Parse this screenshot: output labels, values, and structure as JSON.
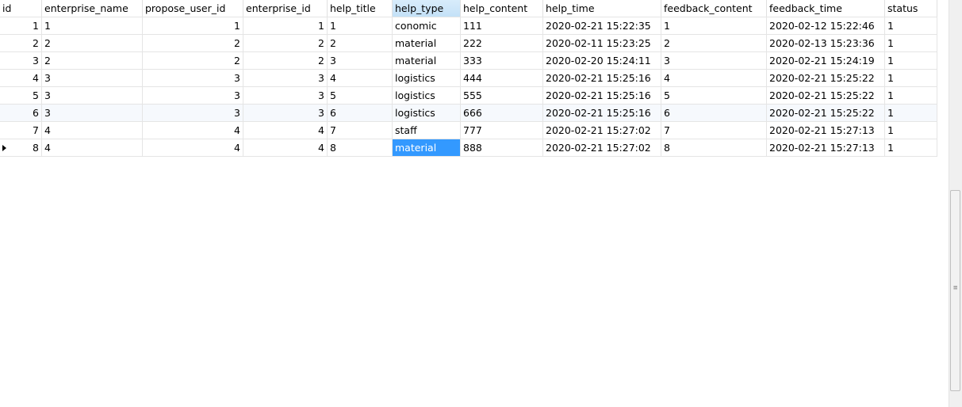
{
  "table": {
    "columns": [
      "id",
      "enterprise_name",
      "propose_user_id",
      "enterprise_id",
      "help_title",
      "help_type",
      "help_content",
      "help_time",
      "feedback_content",
      "feedback_time",
      "status"
    ],
    "sorted_column": "help_type",
    "rows": [
      [
        "1",
        "1",
        "1",
        "1",
        "1",
        "conomic",
        "111",
        "2020-02-21 15:22:35",
        "1",
        "2020-02-12 15:22:46",
        "1"
      ],
      [
        "2",
        "2",
        "2",
        "2",
        "2",
        "material",
        "222",
        "2020-02-11 15:23:25",
        "2",
        "2020-02-13 15:23:36",
        "1"
      ],
      [
        "3",
        "2",
        "2",
        "2",
        "3",
        "material",
        "333",
        "2020-02-20 15:24:11",
        "3",
        "2020-02-21 15:24:19",
        "1"
      ],
      [
        "4",
        "3",
        "3",
        "3",
        "4",
        "logistics",
        "444",
        "2020-02-21 15:25:16",
        "4",
        "2020-02-21 15:25:22",
        "1"
      ],
      [
        "5",
        "3",
        "3",
        "3",
        "5",
        "logistics",
        "555",
        "2020-02-21 15:25:16",
        "5",
        "2020-02-21 15:25:22",
        "1"
      ],
      [
        "6",
        "3",
        "3",
        "3",
        "6",
        "logistics",
        "666",
        "2020-02-21 15:25:16",
        "6",
        "2020-02-21 15:25:22",
        "1"
      ],
      [
        "7",
        "4",
        "4",
        "4",
        "7",
        "staff",
        "777",
        "2020-02-21 15:27:02",
        "7",
        "2020-02-21 15:27:13",
        "1"
      ],
      [
        "8",
        "4",
        "4",
        "4",
        "8",
        "material",
        "888",
        "2020-02-21 15:27:02",
        "8",
        "2020-02-21 15:27:13",
        "1"
      ]
    ],
    "current_row": 8,
    "selected_cell_column": "help_type",
    "selection_color": "#3399ff",
    "header_sort_color": "#c4e1f7"
  },
  "scrollbar": {
    "grip_icon": "grip-lines-icon"
  }
}
